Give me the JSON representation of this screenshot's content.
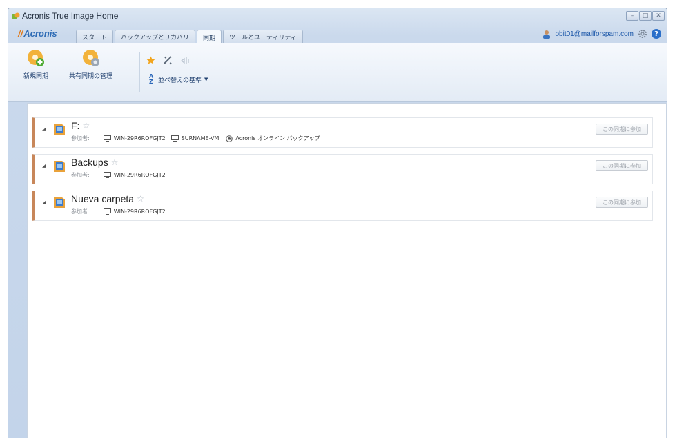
{
  "window": {
    "title": "Acronis True Image Home",
    "controls": {
      "minimize": "–",
      "maximize": "□",
      "close": "✕"
    }
  },
  "brand": {
    "logo_text": "Acronis"
  },
  "tabs": [
    {
      "label": "スタート",
      "active": false
    },
    {
      "label": "バックアップとリカバリ",
      "active": false
    },
    {
      "label": "同期",
      "active": true
    },
    {
      "label": "ツールとユーティリティ",
      "active": false
    }
  ],
  "account": {
    "email": "obit01@mailforspam.com"
  },
  "ribbon": {
    "new_sync_label": "新規同期",
    "manage_shared_label": "共有同期の管理",
    "sort_label": "並べ替えの基準"
  },
  "syncs": [
    {
      "name": "F:",
      "participants_label": "参加者:",
      "participants": [
        "WIN-29R6ROFGJT2",
        "SURNAME-VM"
      ],
      "cloud_participant": "Acronis オンライン バックアップ",
      "join_label": "この同期に参加"
    },
    {
      "name": "Backups",
      "participants_label": "参加者:",
      "participants": [
        "WIN-29R6ROFGJT2"
      ],
      "join_label": "この同期に参加"
    },
    {
      "name": "Nueva carpeta",
      "participants_label": "参加者:",
      "participants": [
        "WIN-29R6ROFGJT2"
      ],
      "join_label": "この同期に参加"
    }
  ],
  "colors": {
    "accent": "#2d6bb5",
    "row_marker": "#c8875a",
    "logo_slash": "#e07a1a"
  },
  "icons": [
    "app-icon",
    "user-icon",
    "gear-icon",
    "help-icon",
    "new-sync-icon",
    "manage-shared-icon",
    "star-icon",
    "tag-icon",
    "share-icon",
    "sort-icon",
    "folder-icon",
    "computer-icon",
    "cloud-icon"
  ]
}
